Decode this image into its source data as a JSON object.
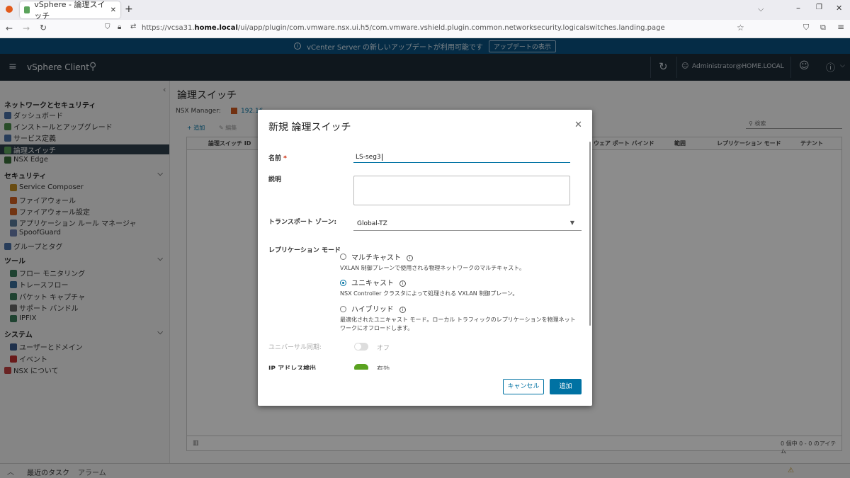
{
  "browser": {
    "tab_title": "vSphere - 論理スイッチ",
    "url_prefix": "https://vcsa31.",
    "url_host": "home.local",
    "url_path": "/ui/app/plugin/com.vmware.nsx.ui.h5/com.vmware.vshield.plugin.common.networksecurity.logicalswitches.landing.page"
  },
  "notice": {
    "text": "vCenter Server の新しいアップデートが利用可能です",
    "button": "アップデートの表示"
  },
  "header": {
    "app_name": "vSphere Client",
    "user": "Administrator@HOME.LOCAL"
  },
  "sidebar": {
    "section_title": "ネットワークとセキュリティ",
    "top_items": [
      {
        "label": "ダッシュボード",
        "icon": "dashboard-icon",
        "color": "#4a6fa5"
      },
      {
        "label": "インストールとアップグレード",
        "icon": "install-icon",
        "color": "#4a8a4a"
      },
      {
        "label": "サービス定義",
        "icon": "service-icon",
        "color": "#4a6fa5"
      },
      {
        "label": "論理スイッチ",
        "icon": "logical-switch-icon",
        "color": "#5ba35b"
      },
      {
        "label": "NSX Edge",
        "icon": "edge-icon",
        "color": "#3a6e3a"
      }
    ],
    "security": {
      "title": "セキュリティ",
      "items": [
        {
          "label": "Service Composer",
          "icon": "composer-icon",
          "color": "#c08a20"
        },
        {
          "label": "ファイアウォール",
          "icon": "firewall-icon",
          "color": "#d06020"
        },
        {
          "label": "ファイアウォール設定",
          "icon": "firewall-settings-icon",
          "color": "#d06020"
        },
        {
          "label": "アプリケーション ルール マネージャ",
          "icon": "app-rule-icon",
          "color": "#5a7a9a"
        },
        {
          "label": "SpoofGuard",
          "icon": "spoofguard-icon",
          "color": "#6a7fb0"
        }
      ]
    },
    "groups_item": {
      "label": "グループとタグ",
      "icon": "groups-icon",
      "color": "#4a6fa5"
    },
    "tools": {
      "title": "ツール",
      "items": [
        {
          "label": "フロー モニタリング",
          "icon": "flow-monitor-icon",
          "color": "#3a7a5a"
        },
        {
          "label": "トレースフロー",
          "icon": "traceflow-icon",
          "color": "#3a6e9a"
        },
        {
          "label": "パケット キャプチャ",
          "icon": "packet-capture-icon",
          "color": "#3a7a5a"
        },
        {
          "label": "サポート バンドル",
          "icon": "support-bundle-icon",
          "color": "#666666"
        },
        {
          "label": "IPFIX",
          "icon": "ipfix-icon",
          "color": "#3a7a5a"
        }
      ]
    },
    "system": {
      "title": "システム",
      "items": [
        {
          "label": "ユーザーとドメイン",
          "icon": "users-icon",
          "color": "#3a5a8a"
        },
        {
          "label": "イベント",
          "icon": "events-icon",
          "color": "#c03030"
        }
      ]
    },
    "about_item": {
      "label": "NSX について",
      "icon": "about-icon",
      "color": "#c04040"
    }
  },
  "main": {
    "title": "論理スイッチ",
    "manager_label": "NSX Manager:",
    "manager_value": "192.16",
    "toolbar": {
      "add": "+ 追加",
      "edit": "編集"
    },
    "search_placeholder": "検索",
    "columns": [
      "論理スイッチ ID",
      "ウェア ポート バインド",
      "範囲",
      "レプリケーション モード",
      "テナント"
    ],
    "footer_count": "0 個中 0 - 0 のアイテム"
  },
  "modal": {
    "title": "新規 論理スイッチ",
    "name_label": "名前",
    "required_mark": "*",
    "name_value": "LS-seg3",
    "description_label": "説明",
    "transport_zone_label": "トランスポート ゾーン:",
    "transport_zone_value": "Global-TZ",
    "replication_label": "レプリケーション モード",
    "options": [
      {
        "label": "マルチキャスト",
        "help": "VXLAN 制御プレーンで使用される物理ネットワークのマルチキャスト。",
        "selected": false
      },
      {
        "label": "ユニキャスト",
        "help": "NSX Controller クラスタによって処理される VXLAN 制御プレーン。",
        "selected": true
      },
      {
        "label": "ハイブリッド",
        "help": "最適化されたユニキャスト モード。ローカル トラフィックのレプリケーションを物理ネットワークにオフロードします。",
        "selected": false
      }
    ],
    "universal_sync_label": "ユニバーサル同期:",
    "universal_sync_value": "オフ",
    "ip_discovery_label": "IP アドレス検出",
    "ip_discovery_value": "有効",
    "cancel": "キャンセル",
    "add": "追加"
  },
  "bottom": {
    "recent_tasks": "最近のタスク",
    "alarms": "アラーム"
  },
  "colors": {
    "accent": "#0072a3",
    "header_bg": "#1c2a36",
    "notice_bg": "#0a5180"
  }
}
